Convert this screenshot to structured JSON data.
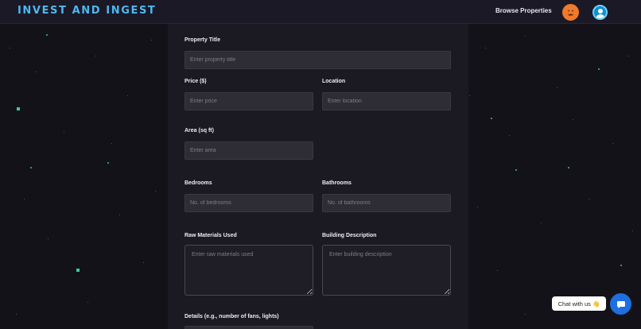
{
  "header": {
    "brand": "INVEST AND INGEST",
    "nav_browse": "Browse Properties",
    "avatar_icon": "pumpkin-avatar-icon",
    "profile_icon": "user-profile-icon"
  },
  "form": {
    "title_label": "Property Title",
    "title_placeholder": "Enter property title",
    "price_label": "Price ($)",
    "price_placeholder": "Enter price",
    "location_label": "Location",
    "location_placeholder": "Enter location",
    "area_label": "Area (sq ft)",
    "area_placeholder": "Enter area",
    "bedrooms_label": "Bedrooms",
    "bedrooms_placeholder": "No. of bedrooms",
    "bathrooms_label": "Bathrooms",
    "bathrooms_placeholder": "No. of bathrooms",
    "materials_label": "Raw Materials Used",
    "materials_placeholder": "Enter raw materials used",
    "description_label": "Building Description",
    "description_placeholder": "Enter building description",
    "details_label": "Details (e.g., number of fans, lights)"
  },
  "chat": {
    "pill_text": "Chat with us 👋",
    "button_icon": "chat-bubble-icon"
  },
  "colors": {
    "brand": "#4fb8f0",
    "accent": "#1e6fe0",
    "star": "#3ad6a6"
  }
}
